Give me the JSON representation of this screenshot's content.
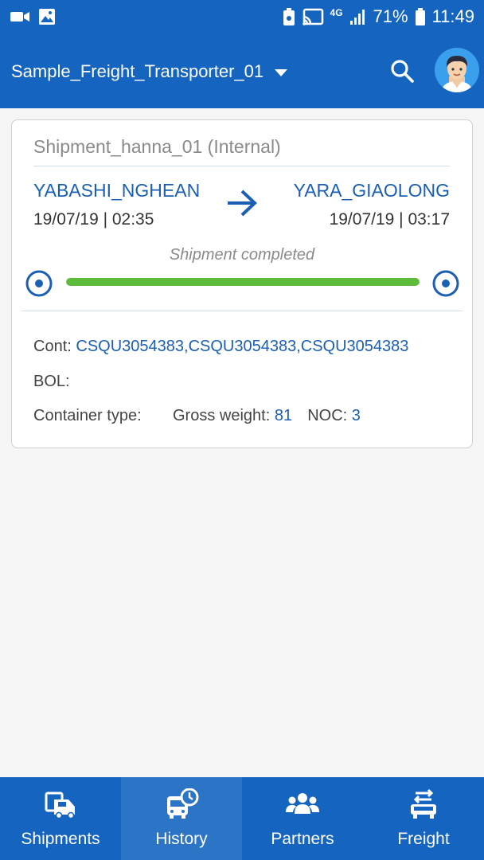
{
  "status_bar": {
    "network": "4G",
    "battery_percent": "71%",
    "time": "11:49"
  },
  "app_bar": {
    "title": "Sample_Freight_Transporter_01"
  },
  "shipment": {
    "title": "Shipment_hanna_01 (Internal)",
    "origin": {
      "name": "YABASHI_NGHEAN",
      "time": "19/07/19 | 02:35"
    },
    "destination": {
      "name": "YARA_GIAOLONG",
      "time": "19/07/19 | 03:17"
    },
    "status": "Shipment completed",
    "progress": 1.0,
    "progress_color": "#5cbc3a",
    "cont_label": "Cont:",
    "cont_value": "CSQU3054383,CSQU3054383,CSQU3054383",
    "bol_label": "BOL:",
    "container_type_label": "Container type:",
    "gross_weight_label": "Gross weight:",
    "gross_weight_value": "81",
    "noc_label": "NOC:",
    "noc_value": "3"
  },
  "nav": {
    "items": [
      {
        "label": "Shipments",
        "icon": "truck-icon",
        "active": false
      },
      {
        "label": "History",
        "icon": "bus-clock-icon",
        "active": true
      },
      {
        "label": "Partners",
        "icon": "group-icon",
        "active": false
      },
      {
        "label": "Freight",
        "icon": "freight-swap-icon",
        "active": false
      }
    ]
  },
  "colors": {
    "primary": "#1565c0",
    "link": "#1a5fb4",
    "active_tab": "#2b74c6"
  }
}
